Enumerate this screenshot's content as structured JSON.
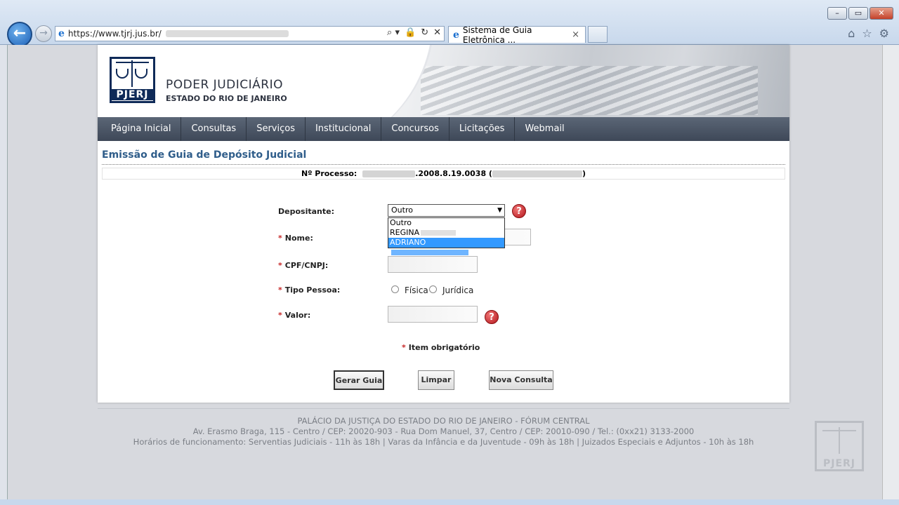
{
  "browser": {
    "url": "https://www.tjrj.jus.br/",
    "tab_title": "Sistema de Guia Eletrônica ...",
    "tab_close": "×",
    "window_buttons": [
      "–",
      "▭",
      "✕"
    ],
    "back_glyph": "←",
    "forward_glyph": "→",
    "ie_glyph": "e",
    "addr_tools": [
      "⌕ ▾",
      "🔒",
      "↻",
      "✕"
    ],
    "right_icons": [
      "⌂",
      "☆",
      "⚙"
    ]
  },
  "header": {
    "logo_text": "PJERJ",
    "org_title": "PODER JUDICIÁRIO",
    "org_subtitle": "ESTADO DO RIO DE JANEIRO"
  },
  "nav": {
    "items": [
      "Página Inicial",
      "Consultas",
      "Serviços",
      "Institucional",
      "Concursos",
      "Licitações",
      "Webmail"
    ]
  },
  "form": {
    "title": "Emissão de Guia de Depósito Judicial",
    "processo_label": "Nº Processo:",
    "processo_visible": ".2008.8.19.0038 (",
    "processo_close": ")",
    "depositante_label": "Depositante:",
    "depositante_selected": "Outro",
    "depositante_options": [
      "Outro",
      "REGINA",
      "ADRIANO"
    ],
    "nome_label": "Nome:",
    "cpf_label": "CPF/CNPJ:",
    "tipo_label": "Tipo Pessoa:",
    "tipo_options": [
      "Física",
      "Jurídica"
    ],
    "valor_label": "Valor:",
    "required_mark": "*",
    "required_note": "Item obrigatório",
    "help_glyph": "?",
    "buttons": {
      "gerar": "Gerar Guia",
      "limpar": "Limpar",
      "nova": "Nova Consulta"
    }
  },
  "footer": {
    "line1": "PALÁCIO DA JUSTIÇA DO ESTADO DO RIO DE JANEIRO - FÓRUM CENTRAL",
    "line2": "Av. Erasmo Braga, 115 - Centro / CEP: 20020-903 - Rua Dom Manuel, 37, Centro / CEP: 20010-090 / Tel.: (0xx21) 3133-2000",
    "line3": "Horários de funcionamento: Serventias Judiciais - 11h às 18h | Varas da Infância e da Juventude - 09h às 18h | Juizados Especiais e Adjuntos - 10h às 18h",
    "logo_text": "PJERJ"
  }
}
